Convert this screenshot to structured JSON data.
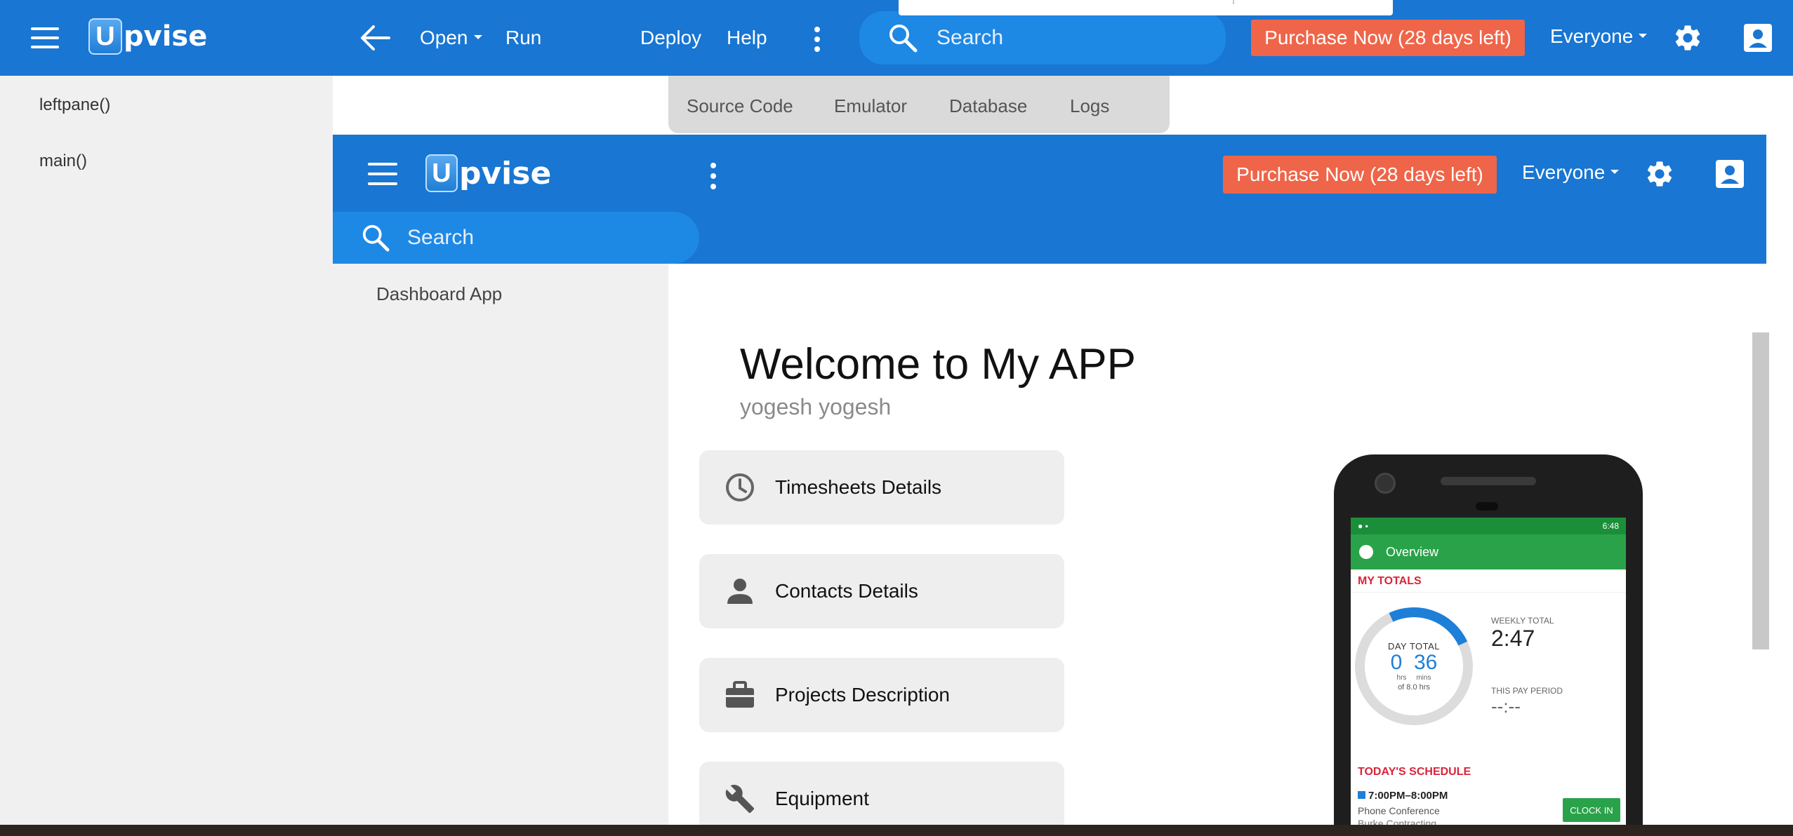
{
  "topbar": {
    "logo_letter": "U",
    "logo_text": "pvise",
    "open_label": "Open",
    "run_label": "Run",
    "deploy_label": "Deploy",
    "help_label": "Help",
    "search_placeholder": "Search",
    "purchase_label": "Purchase Now (28 days left)",
    "user_scope": "Everyone"
  },
  "leftpane": {
    "items": [
      {
        "label": "leftpane()"
      },
      {
        "label": "main()"
      }
    ]
  },
  "tabs": [
    {
      "label": "Source Code"
    },
    {
      "label": "Emulator"
    },
    {
      "label": "Database"
    },
    {
      "label": "Logs"
    }
  ],
  "emulator": {
    "logo_letter": "U",
    "logo_text": "pvise",
    "purchase_label": "Purchase Now (28 days left)",
    "user_scope": "Everyone",
    "search_placeholder": "Search",
    "left_items": [
      {
        "label": "Dashboard App"
      }
    ],
    "welcome_title": "Welcome to My APP",
    "username": "yogesh yogesh",
    "cards": [
      {
        "label": "Timesheets Details",
        "icon": "clock-icon"
      },
      {
        "label": "Contacts Details",
        "icon": "person-icon"
      },
      {
        "label": "Projects Description",
        "icon": "briefcase-icon"
      },
      {
        "label": "Equipment",
        "icon": "wrench-icon"
      }
    ]
  },
  "phone": {
    "time": "6:48",
    "appbar_title": "Overview",
    "my_totals": "MY TOTALS",
    "day_total_label": "DAY TOTAL",
    "day_hrs": "0",
    "day_mins": "36",
    "hrs_unit": "hrs",
    "mins_unit": "mins",
    "of_total": "of 8.0 hrs",
    "weekly_total_label": "WEEKLY TOTAL",
    "weekly_total": "2:47",
    "pay_period_label": "THIS PAY PERIOD",
    "pay_period": "--:--",
    "schedule_title": "TODAY'S SCHEDULE",
    "schedule_time": "7:00PM–8:00PM",
    "schedule_desc": "Phone Conference",
    "schedule_desc2": "Burke Contracting",
    "clock_in": "CLOCK IN"
  },
  "colors": {
    "primary": "#1976d2",
    "search": "#1e88e5",
    "purchase": "#ef6549",
    "pane": "#f0f0f0",
    "card": "#eeeeee",
    "phone_green": "#2aa24a",
    "accent_red": "#d9243a"
  }
}
